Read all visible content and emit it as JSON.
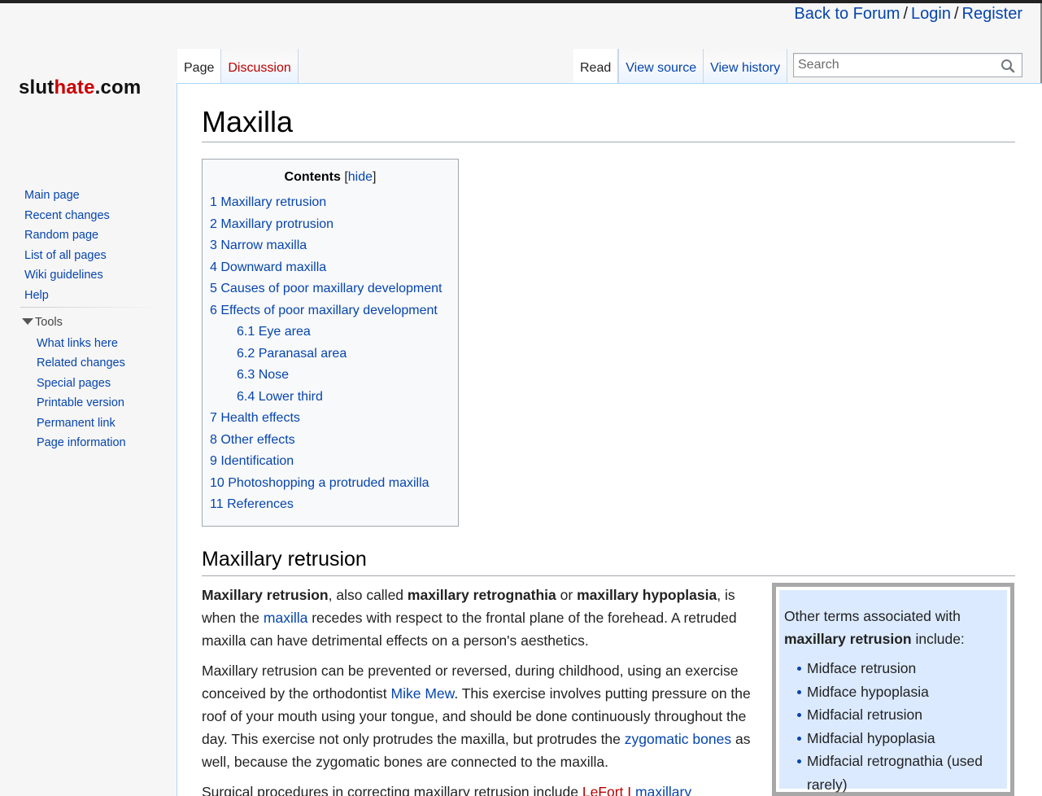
{
  "topbar": {
    "back_to_forum": "Back to Forum",
    "sep1": "/",
    "login": "Login",
    "sep2": "/",
    "register": "Register"
  },
  "logo": {
    "part1": "slut",
    "part2": "hate",
    "part3": ".com"
  },
  "sidebar": {
    "nav": [
      "Main page",
      "Recent changes",
      "Random page",
      "List of all pages",
      "Wiki guidelines",
      "Help"
    ],
    "tools_heading": "Tools",
    "tools": [
      "What links here",
      "Related changes",
      "Special pages",
      "Printable version",
      "Permanent link",
      "Page information"
    ]
  },
  "tabs": {
    "page": "Page",
    "discussion": "Discussion",
    "read": "Read",
    "view_source": "View source",
    "view_history": "View history"
  },
  "search": {
    "placeholder": "Search"
  },
  "article": {
    "title": "Maxilla",
    "toc": {
      "heading": "Contents",
      "hide_open": "[",
      "hide": "hide",
      "hide_close": "]",
      "items": [
        {
          "num": "1",
          "label": "Maxillary retrusion",
          "sub": false
        },
        {
          "num": "2",
          "label": "Maxillary protrusion",
          "sub": false
        },
        {
          "num": "3",
          "label": "Narrow maxilla",
          "sub": false
        },
        {
          "num": "4",
          "label": "Downward maxilla",
          "sub": false
        },
        {
          "num": "5",
          "label": "Causes of poor maxillary development",
          "sub": false
        },
        {
          "num": "6",
          "label": "Effects of poor maxillary development",
          "sub": false
        },
        {
          "num": "6.1",
          "label": "Eye area",
          "sub": true
        },
        {
          "num": "6.2",
          "label": "Paranasal area",
          "sub": true
        },
        {
          "num": "6.3",
          "label": "Nose",
          "sub": true
        },
        {
          "num": "6.4",
          "label": "Lower third",
          "sub": true
        },
        {
          "num": "7",
          "label": "Health effects",
          "sub": false
        },
        {
          "num": "8",
          "label": "Other effects",
          "sub": false
        },
        {
          "num": "9",
          "label": "Identification",
          "sub": false
        },
        {
          "num": "10",
          "label": "Photoshopping a protruded maxilla",
          "sub": false
        },
        {
          "num": "11",
          "label": "References",
          "sub": false
        }
      ]
    },
    "section1_heading": "Maxillary retrusion",
    "p1": {
      "b1": "Maxillary retrusion",
      "t1": ", also called ",
      "b2": "maxillary retrognathia",
      "t2": " or ",
      "b3": "maxillary hypoplasia",
      "t3": ", is when the ",
      "link_maxilla": "maxilla",
      "t4": " recedes with respect to the frontal plane of the forehead. A retruded maxilla can have detrimental effects on a person's aesthetics."
    },
    "p2": {
      "t1": "Maxillary retrusion can be prevented or reversed, during childhood, using an exercise conceived by the orthodontist ",
      "link_mike_mew": "Mike Mew",
      "t2": ". This exercise involves putting pressure on the roof of your mouth using your tongue, and should be done continuously throughout the day. This exercise not only protrudes the maxilla, but protrudes the ",
      "link_zygomatic": "zygomatic bones",
      "t3": " as well, because the zygomatic bones are connected to the maxilla."
    },
    "p3": {
      "t1": "Surgical procedures in correcting maxillary retrusion include ",
      "link_lefort": "LeFort I",
      "t2": " ",
      "link_maxillary": "maxillary"
    },
    "infobox": {
      "intro": "Other terms associated with ",
      "bold": "maxillary retrusion",
      "tail": " include:",
      "items": [
        "Midface retrusion",
        "Midface hypoplasia",
        "Midfacial retrusion",
        "Midfacial hypoplasia",
        "Midfacial retrognathia (used rarely)"
      ]
    }
  }
}
